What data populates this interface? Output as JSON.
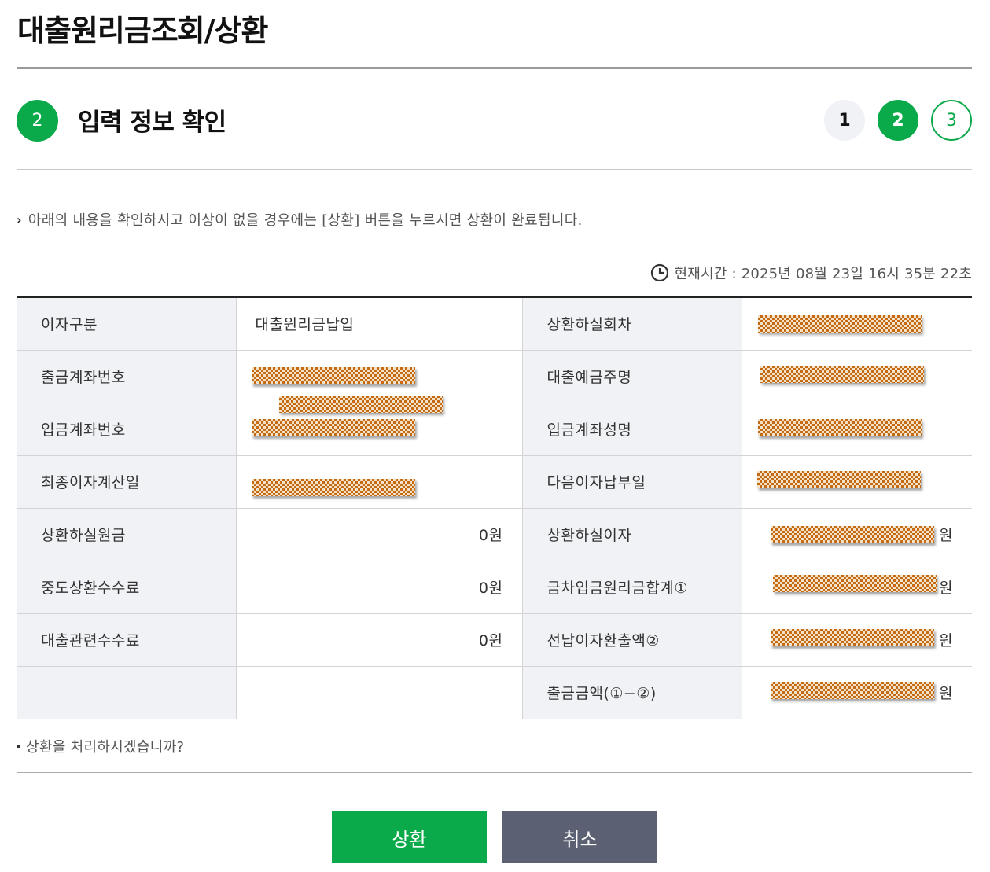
{
  "page": {
    "title": "대출원리금조회/상환"
  },
  "step": {
    "current_badge": "2",
    "title": "입력 정보 확인",
    "indicators": [
      "1",
      "2",
      "3"
    ]
  },
  "notice": "아래의 내용을 확인하시고 이상이 없을 경우에는 [상환] 버튼을 누르시면 상환이 완료됩니다.",
  "clock": {
    "icon": "clock-icon",
    "text": "현재시간 : 2025년 08월 23일 16시 35분 22초"
  },
  "table": {
    "rows": [
      {
        "l1": "이자구분",
        "v1": "대출원리금납입",
        "l2": "상환하실회차",
        "v2": ""
      },
      {
        "l1": "출금계좌번호",
        "v1": "",
        "l2": "대출예금주명",
        "v2": ""
      },
      {
        "l1": "입금계좌번호",
        "v1": "",
        "l2": "입금계좌성명",
        "v2": ""
      },
      {
        "l1": "최종이자계산일",
        "v1": "",
        "l2": "다음이자납부일",
        "v2": ""
      },
      {
        "l1": "상환하실원금",
        "v1": "0원",
        "l2": "상환하실이자",
        "v2": "원"
      },
      {
        "l1": "중도상환수수료",
        "v1": "0원",
        "l2": "금차입금원리금합계①",
        "v2": "원"
      },
      {
        "l1": "대출관련수수료",
        "v1": "0원",
        "l2": "선납이자환출액②",
        "v2": "원"
      },
      {
        "l1": "",
        "v1": "",
        "l2": "출금금액(①−②)",
        "v2": "원"
      }
    ]
  },
  "question": "상환을 처리하시겠습니까?",
  "buttons": {
    "confirm": "상환",
    "cancel": "취소"
  },
  "colors": {
    "accent": "#0aa949",
    "cancel": "#5b6172",
    "header_cell": "#f1f2f5"
  }
}
